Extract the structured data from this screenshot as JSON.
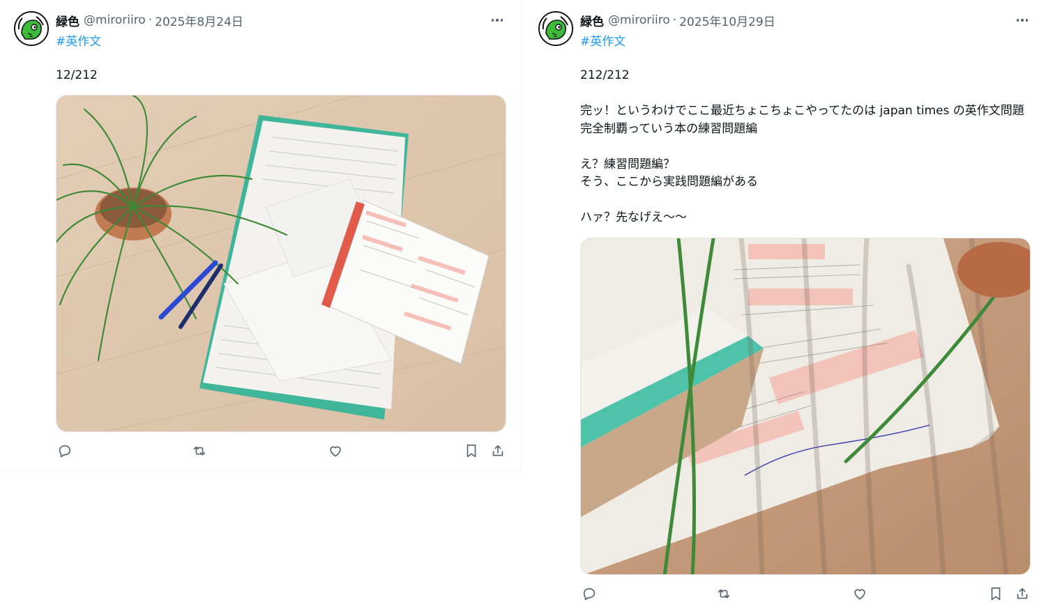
{
  "tweets": [
    {
      "author_name": "緑色",
      "handle": "@miroriiro",
      "separator": "·",
      "date": "2025年8月24日",
      "hashtag": "#英作文",
      "text": "12/212",
      "image_alt": "Photo of open workbook and notebook with handwritten English compositions on a wooden floor, next to a potted plant and two blue pens"
    },
    {
      "author_name": "緑色",
      "handle": "@miroriiro",
      "separator": "·",
      "date": "2025年10月29日",
      "hashtag": "#英作文",
      "text": "212/212\n\n完ッ！というわけでここ最近ちょこちょこやってたのは japan times の英作文問題完全制覇っていう本の練習問題編\n\nえ？練習問題編？\nそう、ここから実践問題編がある\n\nハァ？先なげえ〜〜",
      "image_alt": "Close-up photo of a finished workbook page with handwritten note, plant leaves casting shadows"
    }
  ],
  "icons": {
    "reply": "reply-icon",
    "retweet": "retweet-icon",
    "like": "heart-icon",
    "bookmark": "bookmark-icon",
    "share": "share-icon",
    "more": "more-icon"
  },
  "colors": {
    "link": "#1d9bf0",
    "secondary_text": "#536471",
    "avatar_green": "#3dbb3a"
  }
}
